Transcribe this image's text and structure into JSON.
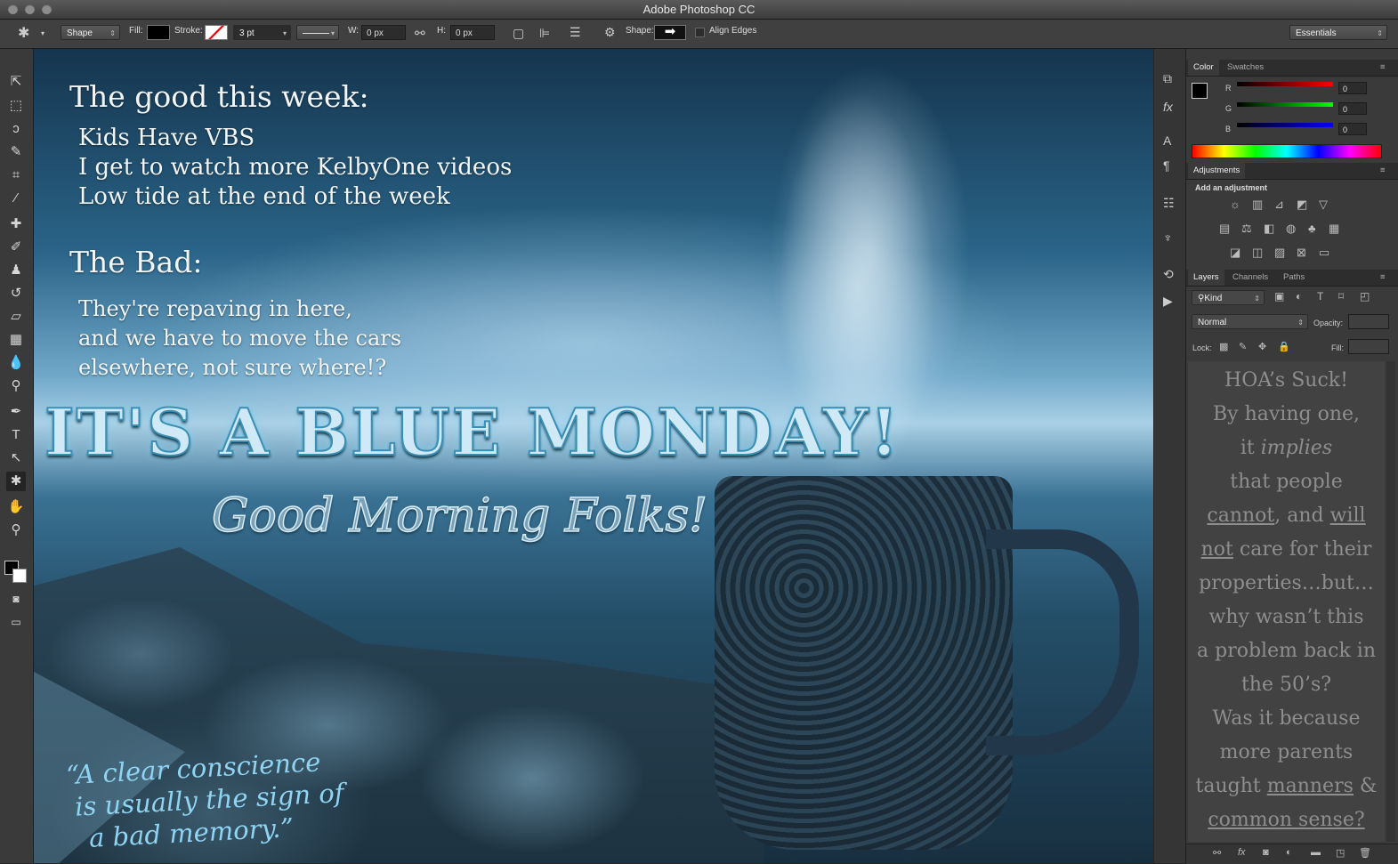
{
  "window": {
    "title": "Adobe Photoshop CC"
  },
  "options_bar": {
    "mode_select": "Shape",
    "fill_label": "Fill:",
    "stroke_label": "Stroke:",
    "stroke_size": "3 pt",
    "w_label": "W:",
    "w_value": "0 px",
    "h_label": "H:",
    "h_value": "0 px",
    "shape_label": "Shape:",
    "align_edges_label": "Align Edges",
    "workspace": "Essentials"
  },
  "canvas": {
    "good_heading": "The good this week:",
    "good_items": [
      "Kids Have VBS",
      "I get to watch more KelbyOne videos",
      "Low tide at the end of the week"
    ],
    "bad_heading": "The Bad:",
    "bad_items": [
      "They're repaving in here,",
      "and we have to move the cars",
      "elsewhere, not sure where!?"
    ],
    "headline": "IT'S A BLUE MONDAY!",
    "subheadline": "Good Morning Folks!",
    "quote_lines": [
      "“A clear conscience",
      "is usually the sign of",
      "a bad memory.”"
    ]
  },
  "color_panel": {
    "tabs": [
      "Color",
      "Swatches"
    ],
    "r_label": "R",
    "g_label": "G",
    "b_label": "B",
    "r": "0",
    "g": "0",
    "b": "0"
  },
  "adjustments_panel": {
    "tab": "Adjustments",
    "subtitle": "Add an adjustment"
  },
  "layers_panel": {
    "tabs": [
      "Layers",
      "Channels",
      "Paths"
    ],
    "filter_kind": "Kind",
    "blend_mode": "Normal",
    "opacity_label": "Opacity:",
    "lock_label": "Lock:",
    "fill_label": "Fill:",
    "note": {
      "line1": "HOA’s Suck!",
      "line2": "By having one,",
      "line3_a": "it ",
      "line3_b": "implies",
      "line4": "that people",
      "line5_a": "cannot",
      "line5_b": ", and ",
      "line5_c": "will",
      "line6_a": "not",
      "line6_b": " care for their",
      "line7": "properties…but…",
      "line8": "why wasn’t this",
      "line9": "a problem back in",
      "line10": "the 50’s?",
      "line11": "Was it because",
      "line12": "more parents",
      "line13_a": "taught ",
      "line13_b": "manners",
      "line13_c": " &",
      "line14": "common sense?"
    }
  }
}
